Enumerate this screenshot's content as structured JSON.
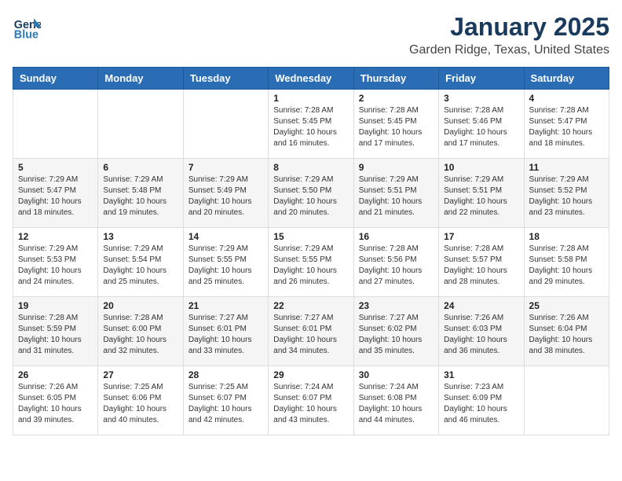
{
  "header": {
    "logo_line1": "General",
    "logo_line2": "Blue",
    "title": "January 2025",
    "subtitle": "Garden Ridge, Texas, United States"
  },
  "weekdays": [
    "Sunday",
    "Monday",
    "Tuesday",
    "Wednesday",
    "Thursday",
    "Friday",
    "Saturday"
  ],
  "weeks": [
    [
      {
        "day": "",
        "info": ""
      },
      {
        "day": "",
        "info": ""
      },
      {
        "day": "",
        "info": ""
      },
      {
        "day": "1",
        "info": "Sunrise: 7:28 AM\nSunset: 5:45 PM\nDaylight: 10 hours\nand 16 minutes."
      },
      {
        "day": "2",
        "info": "Sunrise: 7:28 AM\nSunset: 5:45 PM\nDaylight: 10 hours\nand 17 minutes."
      },
      {
        "day": "3",
        "info": "Sunrise: 7:28 AM\nSunset: 5:46 PM\nDaylight: 10 hours\nand 17 minutes."
      },
      {
        "day": "4",
        "info": "Sunrise: 7:28 AM\nSunset: 5:47 PM\nDaylight: 10 hours\nand 18 minutes."
      }
    ],
    [
      {
        "day": "5",
        "info": "Sunrise: 7:29 AM\nSunset: 5:47 PM\nDaylight: 10 hours\nand 18 minutes."
      },
      {
        "day": "6",
        "info": "Sunrise: 7:29 AM\nSunset: 5:48 PM\nDaylight: 10 hours\nand 19 minutes."
      },
      {
        "day": "7",
        "info": "Sunrise: 7:29 AM\nSunset: 5:49 PM\nDaylight: 10 hours\nand 20 minutes."
      },
      {
        "day": "8",
        "info": "Sunrise: 7:29 AM\nSunset: 5:50 PM\nDaylight: 10 hours\nand 20 minutes."
      },
      {
        "day": "9",
        "info": "Sunrise: 7:29 AM\nSunset: 5:51 PM\nDaylight: 10 hours\nand 21 minutes."
      },
      {
        "day": "10",
        "info": "Sunrise: 7:29 AM\nSunset: 5:51 PM\nDaylight: 10 hours\nand 22 minutes."
      },
      {
        "day": "11",
        "info": "Sunrise: 7:29 AM\nSunset: 5:52 PM\nDaylight: 10 hours\nand 23 minutes."
      }
    ],
    [
      {
        "day": "12",
        "info": "Sunrise: 7:29 AM\nSunset: 5:53 PM\nDaylight: 10 hours\nand 24 minutes."
      },
      {
        "day": "13",
        "info": "Sunrise: 7:29 AM\nSunset: 5:54 PM\nDaylight: 10 hours\nand 25 minutes."
      },
      {
        "day": "14",
        "info": "Sunrise: 7:29 AM\nSunset: 5:55 PM\nDaylight: 10 hours\nand 25 minutes."
      },
      {
        "day": "15",
        "info": "Sunrise: 7:29 AM\nSunset: 5:55 PM\nDaylight: 10 hours\nand 26 minutes."
      },
      {
        "day": "16",
        "info": "Sunrise: 7:28 AM\nSunset: 5:56 PM\nDaylight: 10 hours\nand 27 minutes."
      },
      {
        "day": "17",
        "info": "Sunrise: 7:28 AM\nSunset: 5:57 PM\nDaylight: 10 hours\nand 28 minutes."
      },
      {
        "day": "18",
        "info": "Sunrise: 7:28 AM\nSunset: 5:58 PM\nDaylight: 10 hours\nand 29 minutes."
      }
    ],
    [
      {
        "day": "19",
        "info": "Sunrise: 7:28 AM\nSunset: 5:59 PM\nDaylight: 10 hours\nand 31 minutes."
      },
      {
        "day": "20",
        "info": "Sunrise: 7:28 AM\nSunset: 6:00 PM\nDaylight: 10 hours\nand 32 minutes."
      },
      {
        "day": "21",
        "info": "Sunrise: 7:27 AM\nSunset: 6:01 PM\nDaylight: 10 hours\nand 33 minutes."
      },
      {
        "day": "22",
        "info": "Sunrise: 7:27 AM\nSunset: 6:01 PM\nDaylight: 10 hours\nand 34 minutes."
      },
      {
        "day": "23",
        "info": "Sunrise: 7:27 AM\nSunset: 6:02 PM\nDaylight: 10 hours\nand 35 minutes."
      },
      {
        "day": "24",
        "info": "Sunrise: 7:26 AM\nSunset: 6:03 PM\nDaylight: 10 hours\nand 36 minutes."
      },
      {
        "day": "25",
        "info": "Sunrise: 7:26 AM\nSunset: 6:04 PM\nDaylight: 10 hours\nand 38 minutes."
      }
    ],
    [
      {
        "day": "26",
        "info": "Sunrise: 7:26 AM\nSunset: 6:05 PM\nDaylight: 10 hours\nand 39 minutes."
      },
      {
        "day": "27",
        "info": "Sunrise: 7:25 AM\nSunset: 6:06 PM\nDaylight: 10 hours\nand 40 minutes."
      },
      {
        "day": "28",
        "info": "Sunrise: 7:25 AM\nSunset: 6:07 PM\nDaylight: 10 hours\nand 42 minutes."
      },
      {
        "day": "29",
        "info": "Sunrise: 7:24 AM\nSunset: 6:07 PM\nDaylight: 10 hours\nand 43 minutes."
      },
      {
        "day": "30",
        "info": "Sunrise: 7:24 AM\nSunset: 6:08 PM\nDaylight: 10 hours\nand 44 minutes."
      },
      {
        "day": "31",
        "info": "Sunrise: 7:23 AM\nSunset: 6:09 PM\nDaylight: 10 hours\nand 46 minutes."
      },
      {
        "day": "",
        "info": ""
      }
    ]
  ]
}
